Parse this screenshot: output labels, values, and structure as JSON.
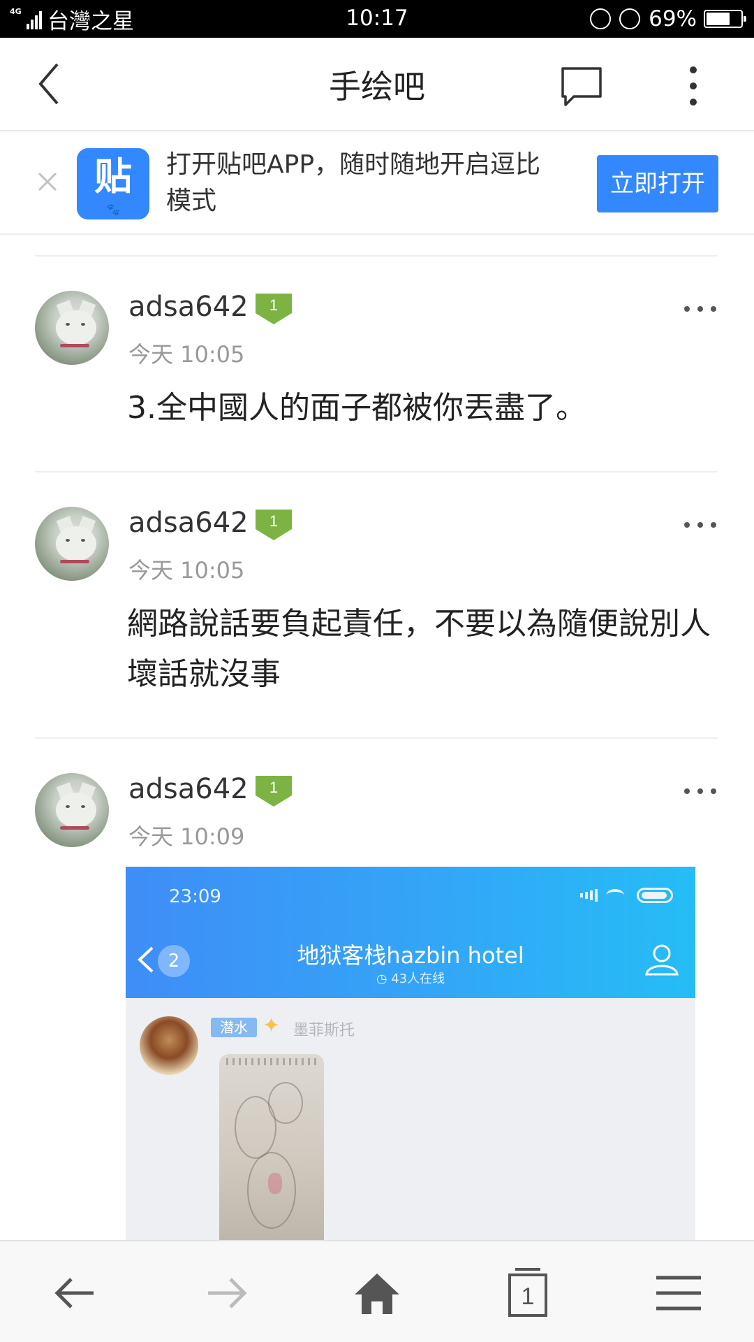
{
  "status_bar": {
    "network": "4G",
    "carrier": "台灣之星",
    "time": "10:17",
    "battery": "69%",
    "battery_level": 0.69
  },
  "header": {
    "title": "手绘吧",
    "back_icon": "chevron-left-icon",
    "chat_icon": "chat-bubble-icon",
    "more_icon": "vertical-dots-icon"
  },
  "app_banner": {
    "close_icon": "close-icon",
    "app_icon_label": "贴",
    "text": "打开贴吧APP，随时随地开启逗比模式",
    "button": "立即打开"
  },
  "posts": [
    {
      "username": "adsa642",
      "level": "1",
      "time": "今天 10:05",
      "content": "3.全中國人的面子都被你丟盡了。"
    },
    {
      "username": "adsa642",
      "level": "1",
      "time": "今天 10:05",
      "content": "網路說話要負起責任，不要以為隨便說別人壞話就沒事"
    },
    {
      "username": "adsa642",
      "level": "1",
      "time": "今天 10:09",
      "image": {
        "status_time": "23:09",
        "unread_count": "2",
        "title": "地狱客栈hazbin hotel",
        "online": "43人在线",
        "tag": "潜水",
        "name": "墨菲斯托"
      }
    }
  ],
  "bottom_nav": [
    "back-arrow-icon",
    "forward-arrow-icon",
    "home-icon",
    "tabs-icon",
    "menu-icon"
  ],
  "tabs_count": "1",
  "colors": {
    "accent": "#3388ff",
    "level_badge": "#7cb342",
    "muted_text": "#999999"
  }
}
